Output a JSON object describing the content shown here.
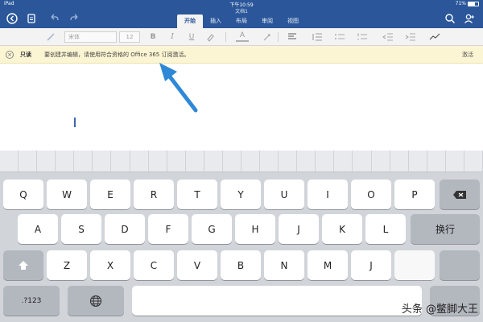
{
  "status_bar": {
    "device": "iPad",
    "wifi_icon": "wifi-icon",
    "time": "下午10:59",
    "battery": "71%"
  },
  "title_bar": {
    "document_name": "文档1",
    "tabs": [
      {
        "label": "开始",
        "active": true
      },
      {
        "label": "插入",
        "active": false
      },
      {
        "label": "布局",
        "active": false
      },
      {
        "label": "审阅",
        "active": false
      },
      {
        "label": "视图",
        "active": false
      }
    ],
    "icons": [
      "back-icon",
      "file-icon",
      "undo-icon",
      "redo-icon",
      "search-icon",
      "share-person-icon"
    ]
  },
  "ribbon": {
    "font_name": "宋体",
    "font_size": "12",
    "buttons": [
      "B",
      "I",
      "U",
      "A"
    ],
    "icons": [
      "format-painter-icon",
      "bold-icon",
      "italic-icon",
      "underline-icon",
      "highlight-icon",
      "font-color-icon",
      "align-icon",
      "bullet-list-icon",
      "numbered-list-icon",
      "decrease-indent-icon",
      "increase-indent-icon",
      "more-icon"
    ]
  },
  "notice": {
    "label": "只读",
    "message": "要创建并编辑，请使用符合资格的 Office 365 订阅激活。",
    "action": "激活",
    "accent": "#fcf5d3"
  },
  "keyboard": {
    "row1": [
      "Q",
      "W",
      "E",
      "R",
      "T",
      "Y",
      "U",
      "I",
      "O",
      "P"
    ],
    "row2": [
      "A",
      "S",
      "D",
      "F",
      "G",
      "H",
      "J",
      "K",
      "L"
    ],
    "row3": [
      "Z",
      "X",
      "C",
      "V",
      "B",
      "N",
      "M"
    ],
    "return_label": "换行",
    "numbers_label": ".?123",
    "row3_partial": "J"
  },
  "watermark": "头条 @鳖脚大王",
  "colors": {
    "title_bar": "#2b579a",
    "arrow": "#2f88d6"
  }
}
